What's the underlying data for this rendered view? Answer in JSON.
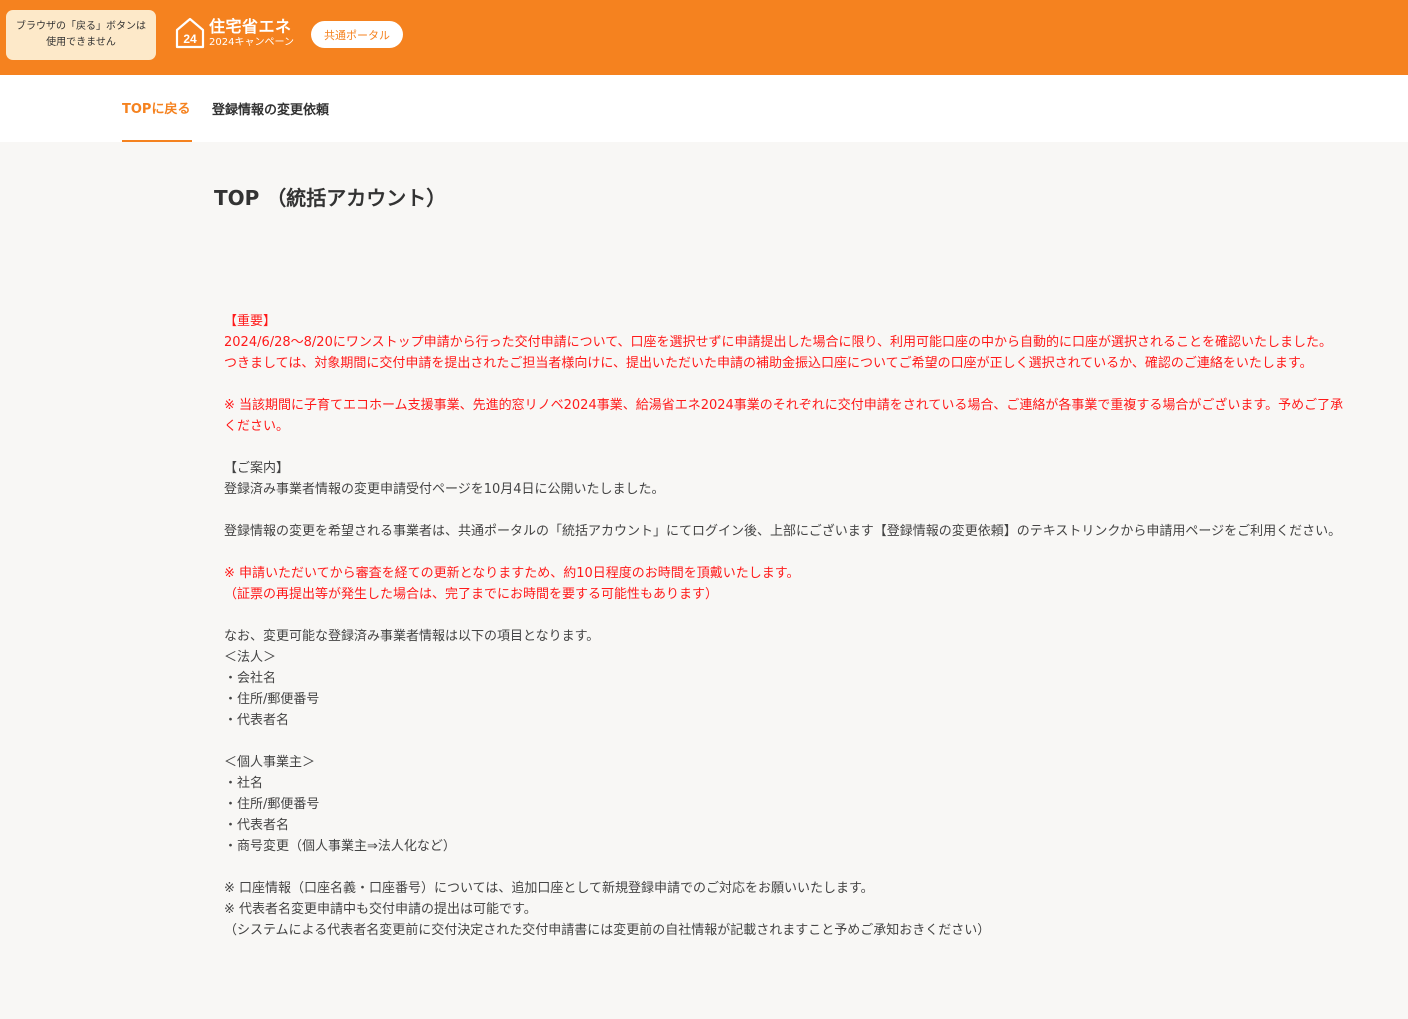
{
  "header": {
    "back_warning_line1": "ブラウザの「戻る」ボタンは",
    "back_warning_line2": "使用できません",
    "logo_number": "24",
    "logo_main": "住宅省エネ",
    "logo_sub": "2024キャンペーン",
    "portal_button": "共通ポータル"
  },
  "nav": {
    "top_link": "TOPに戻る",
    "change_link": "登録情報の変更依頼"
  },
  "page": {
    "title": "TOP （統括アカウント）"
  },
  "notice": {
    "important_heading": "【重要】",
    "important_p1": "2024/6/28〜8/20にワンストップ申請から行った交付申請について、口座を選択せずに申請提出した場合に限り、利用可能口座の中から自動的に口座が選択されることを確認いたしました。",
    "important_p2": "つきましては、対象期間に交付申請を提出されたご担当者様向けに、提出いただいた申請の補助金振込口座についてご希望の口座が正しく選択されているか、確認のご連絡をいたします。",
    "important_note": "※ 当該期間に子育てエコホーム支援事業、先進的窓リノベ2024事業、給湯省エネ2024事業のそれぞれに交付申請をされている場合、ご連絡が各事業で重複する場合がございます。予めご了承ください。",
    "guide_heading": "【ご案内】",
    "guide_p1": "登録済み事業者情報の変更申請受付ページを10月4日に公開いたしました。",
    "guide_p2": "登録情報の変更を希望される事業者は、共通ポータルの「統括アカウント」にてログイン後、上部にございます【登録情報の変更依頼】のテキストリンクから申請用ページをご利用ください。",
    "guide_note1": "※ 申請いただいてから審査を経ての更新となりますため、約10日程度のお時間を頂戴いたします。",
    "guide_note2": "（証票の再提出等が発生した場合は、完了までにお時間を要する可能性もあります）",
    "items_intro": "なお、変更可能な登録済み事業者情報は以下の項目となります。",
    "corp_heading": "＜法人＞",
    "corp_items": [
      "・会社名",
      "・住所/郵便番号",
      "・代表者名"
    ],
    "indiv_heading": "＜個人事業主＞",
    "indiv_items": [
      "・社名",
      "・住所/郵便番号",
      "・代表者名",
      "・商号変更（個人事業主⇒法人化など）"
    ],
    "foot_note1": "※ 口座情報（口座名義・口座番号）については、追加口座として新規登録申請でのご対応をお願いいたします。",
    "foot_note2": "※ 代表者名変更申請中も交付申請の提出は可能です。",
    "foot_note3": "（システムによる代表者名変更前に交付決定された交付申請書には変更前の自社情報が記載されますこと予めご承知おきください）"
  },
  "colors": {
    "brand_orange": "#f5821f",
    "warning_bg": "#fde9c9",
    "alert_red": "#ff1a1a"
  }
}
